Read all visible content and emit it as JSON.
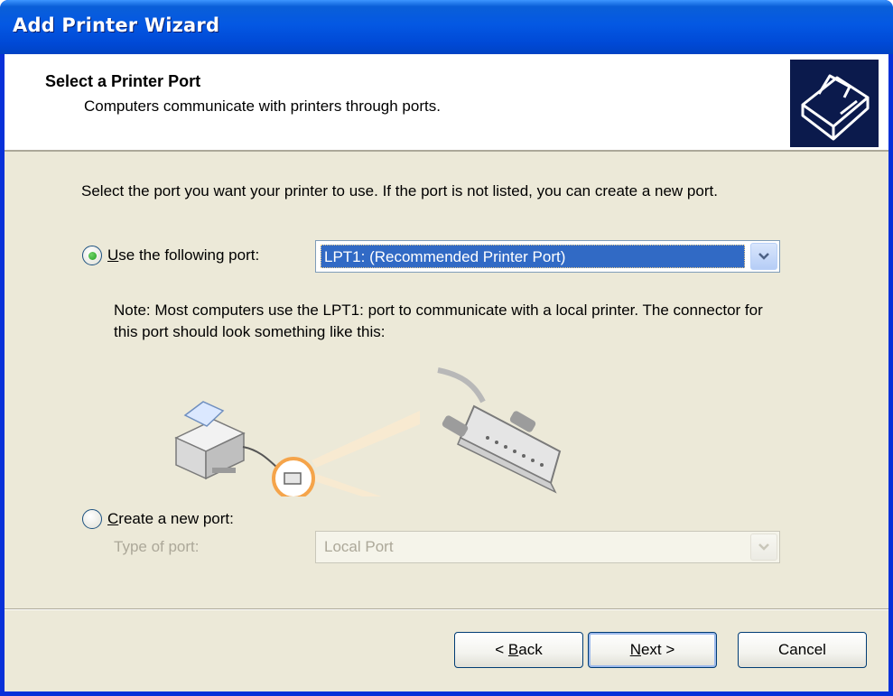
{
  "window": {
    "title": "Add Printer Wizard"
  },
  "header": {
    "title": "Select a Printer Port",
    "subtitle": "Computers communicate with printers through ports.",
    "icon": "printer-wizard-icon"
  },
  "intro_text": "Select the port you want your printer to use.  If the port is not listed, you can create a new port.",
  "use_port": {
    "label_prefix": "",
    "label_accel": "U",
    "label_rest": "se the following port:",
    "checked": true,
    "selected_value": "LPT1: (Recommended Printer Port)"
  },
  "note_text": "Note: Most computers use the LPT1: port to communicate with a local printer. The connector for this port should look something like this:",
  "create_port": {
    "label_accel": "C",
    "label_rest": "reate a new port:",
    "checked": false,
    "type_label": "Type of port:",
    "type_value": "Local Port"
  },
  "buttons": {
    "back_prefix": "< ",
    "back_accel": "B",
    "back_rest": "ack",
    "next_accel": "N",
    "next_rest": "ext >",
    "cancel": "Cancel"
  },
  "colors": {
    "title_bar": "#0458e3",
    "dialog_bg": "#ece9d8",
    "selection": "#316ac5",
    "accent_orange": "#f5a44a"
  }
}
